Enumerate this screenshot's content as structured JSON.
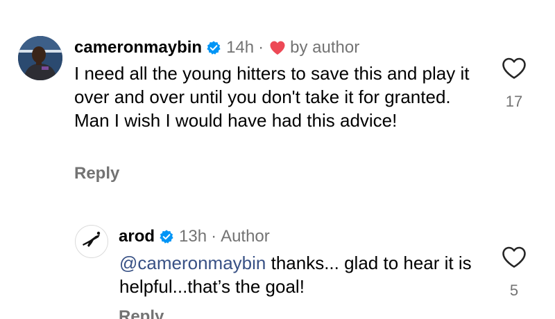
{
  "comments": [
    {
      "username": "cameronmaybin",
      "verified": true,
      "time": "14h",
      "separator": "·",
      "liked_by_author_label": "by author",
      "text": "I need all the young hitters to save this and play it over and over until you don't take it for granted. Man I wish I would have had this advice!",
      "reply_label": "Reply",
      "like_count": "17",
      "heart_color": "#ed4956"
    }
  ],
  "replies": [
    {
      "username": "arod",
      "verified": true,
      "time": "13h",
      "separator": "·",
      "role_label": "Author",
      "mention": "@cameronmaybin",
      "text": " thanks... glad to hear it is helpful...that’s the goal!",
      "reply_label": "Reply",
      "like_count": "5"
    }
  ],
  "colors": {
    "verified_badge": "#0095f6",
    "secondary_text": "#737373",
    "mention_link": "#385185"
  },
  "icons": {
    "verified": "verified-badge-icon",
    "liked_by_author": "heart-filled-icon",
    "like": "heart-outline-icon"
  }
}
